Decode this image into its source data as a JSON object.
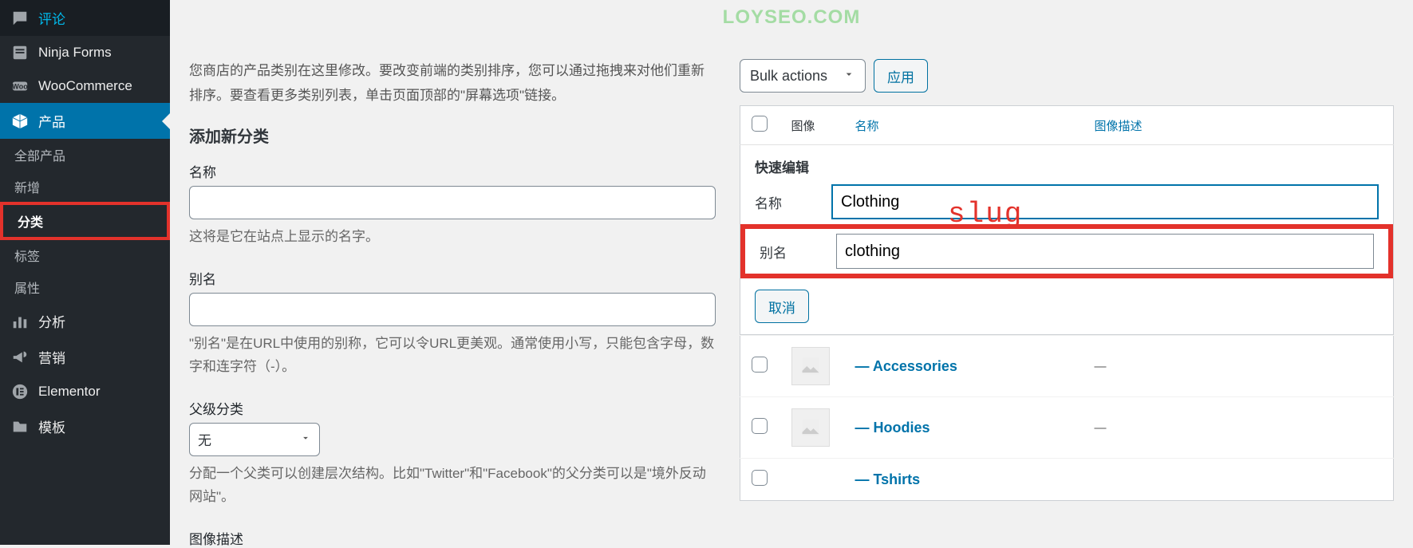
{
  "watermark": "LOYSEO.COM",
  "sidebar": {
    "items": [
      {
        "label": "评论"
      },
      {
        "label": "Ninja Forms"
      },
      {
        "label": "WooCommerce"
      },
      {
        "label": "产品"
      }
    ],
    "product_submenu": [
      {
        "label": "全部产品"
      },
      {
        "label": "新增"
      },
      {
        "label": "分类"
      },
      {
        "label": "标签"
      },
      {
        "label": "属性"
      }
    ],
    "items2": [
      {
        "label": "分析"
      },
      {
        "label": "营销"
      },
      {
        "label": "Elementor"
      },
      {
        "label": "模板"
      }
    ]
  },
  "intro": "您商店的产品类别在这里修改。要改变前端的类别排序，您可以通过拖拽来对他们重新排序。要查看更多类别列表，单击页面顶部的\"屏幕选项\"链接。",
  "add_heading": "添加新分类",
  "form": {
    "name_label": "名称",
    "name_help": "这将是它在站点上显示的名字。",
    "slug_label": "别名",
    "slug_help": "\"别名\"是在URL中使用的别称，它可以令URL更美观。通常使用小写，只能包含字母，数字和连字符（-）。",
    "parent_label": "父级分类",
    "parent_value": "无",
    "parent_help": "分配一个父类可以创建层次结构。比如\"Twitter\"和\"Facebook\"的父分类可以是\"境外反动网站\"。",
    "imgdesc_label": "图像描述"
  },
  "table": {
    "bulk_label": "Bulk actions",
    "apply_label": "应用",
    "col_image": "图像",
    "col_name": "名称",
    "col_imgdesc": "图像描述",
    "qe_title": "快速编辑",
    "qe_name_label": "名称",
    "qe_name_value": "Clothing",
    "qe_slug_label": "别名",
    "qe_slug_value": "clothing",
    "cancel_label": "取消",
    "rows": [
      {
        "name": "— Accessories",
        "desc": "—"
      },
      {
        "name": "— Hoodies",
        "desc": "—"
      },
      {
        "name": "— Tshirts",
        "desc": ""
      }
    ]
  },
  "annotation": "slug"
}
